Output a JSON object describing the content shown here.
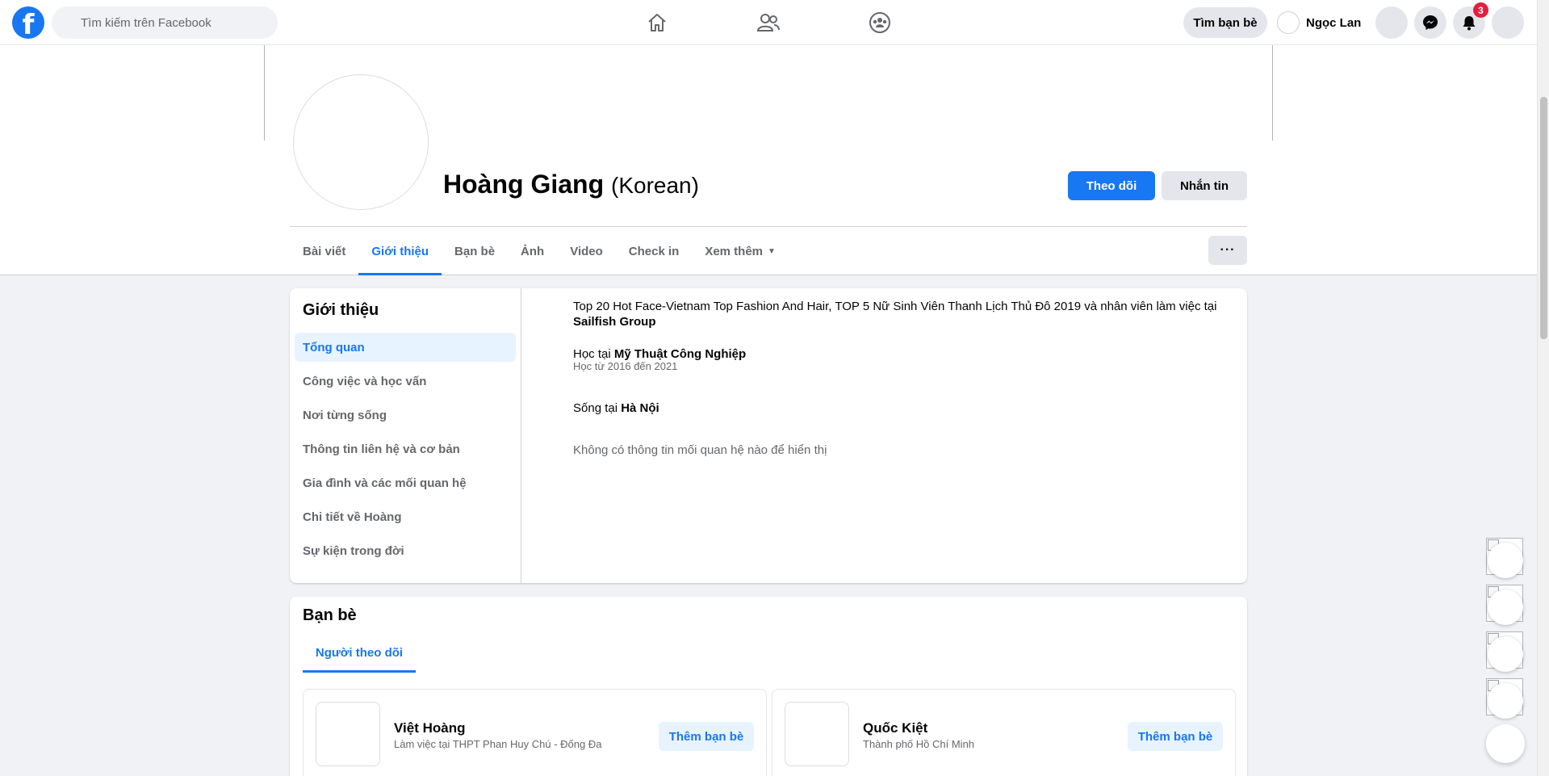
{
  "topbar": {
    "logo_letter": "f",
    "search_placeholder": "Tìm kiếm trên Facebook",
    "find_friends_label": "Tìm bạn bè",
    "user_name": "Ngọc Lan",
    "notifications_count": "3",
    "accent_color": "#1877f2"
  },
  "profile": {
    "name": "Hoàng Giang",
    "alt_name": "(Korean)",
    "follow_label": "Theo dõi",
    "message_label": "Nhắn tin"
  },
  "tabs": [
    {
      "label": "Bài viết",
      "active": false
    },
    {
      "label": "Giới thiệu",
      "active": true
    },
    {
      "label": "Bạn bè",
      "active": false
    },
    {
      "label": "Ảnh",
      "active": false
    },
    {
      "label": "Video",
      "active": false
    },
    {
      "label": "Check in",
      "active": false
    },
    {
      "label": "Xem thêm",
      "active": false
    }
  ],
  "more_menu_label": "···",
  "intro": {
    "title": "Giới thiệu",
    "sidebar": [
      "Tổng quan",
      "Công việc và học vấn",
      "Nơi từng sống",
      "Thông tin liên hệ và cơ bản",
      "Gia đình và các mối quan hệ",
      "Chi tiết về Hoàng",
      "Sự kiện trong đời"
    ],
    "work_text": "Top 20 Hot Face-Vietnam Top Fashion And Hair, TOP 5 Nữ Sinh Viên Thanh Lịch Thủ Đô 2019 và nhân viên làm việc tại",
    "work_place": "Sailfish Group",
    "study_prefix": "Học tại",
    "study_place": "Mỹ Thuật Công Nghiệp",
    "study_period": "Học từ 2016 đến 2021",
    "lives_prefix": "Sống tại",
    "lives_place": "Hà Nội",
    "relationship_empty": "Không có thông tin mối quan hệ nào để hiển thị"
  },
  "friends": {
    "title": "Bạn bè",
    "tab_label": "Người theo dõi",
    "items": [
      {
        "name": "Việt Hoàng",
        "subtitle": "Làm việc tại THPT Phan Huy Chú - Đống Đa",
        "action": "Thêm bạn bè"
      },
      {
        "name": "Quốc Kiệt",
        "subtitle": "Thành phố Hồ Chí Minh",
        "action": "Thêm bạn bè"
      }
    ]
  }
}
